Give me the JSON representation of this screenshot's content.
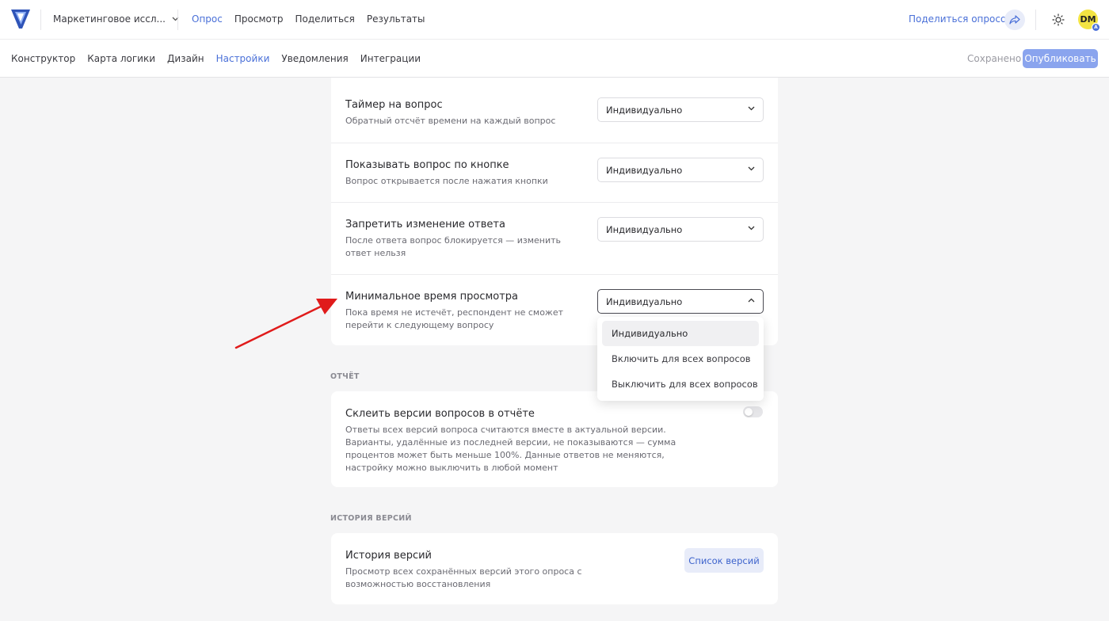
{
  "header": {
    "survey_name": "Маркетинговое иссл...",
    "nav": [
      "Опрос",
      "Просмотр",
      "Поделиться",
      "Результаты"
    ],
    "active_nav": "Опрос",
    "share_label": "Поделиться опросом",
    "avatar_initials": "DM",
    "avatar_badge": "A"
  },
  "subheader": {
    "tabs": [
      "Конструктор",
      "Карта логики",
      "Дизайн",
      "Настройки",
      "Уведомления",
      "Интеграции"
    ],
    "active_tab": "Настройки",
    "saved_label": "Сохранено",
    "publish_label": "Опубликовать"
  },
  "settings": {
    "rows": [
      {
        "title": "Таймер на вопрос",
        "desc": "Обратный отсчёт времени на каждый вопрос",
        "value": "Индивидуально"
      },
      {
        "title": "Показывать вопрос по кнопке",
        "desc": "Вопрос открывается после нажатия кнопки",
        "value": "Индивидуально"
      },
      {
        "title": "Запретить изменение ответа",
        "desc": "После ответа вопрос блокируется — изменить ответ нельзя",
        "value": "Индивидуально"
      },
      {
        "title": "Минимальное время просмотра",
        "desc": "Пока время не истечёт, респондент не сможет перейти к следующему вопросу",
        "value": "Индивидуально"
      }
    ],
    "dropdown_options": [
      "Индивидуально",
      "Включить для всех вопросов",
      "Выключить для всех вопросов"
    ],
    "dropdown_selected": "Индивидуально"
  },
  "report": {
    "section_label": "ОТЧЁТ",
    "title": "Склеить версии вопросов в отчёте",
    "desc": "Ответы всех версий вопроса считаются вместе в актуальной версии. Варианты, удалённые из последней версии, не показываются — сумма процентов может быть меньше 100%. Данные ответов не меняются, настройку можно выключить в любой момент",
    "toggle_on": false
  },
  "history": {
    "section_label": "ИСТОРИЯ ВЕРСИЙ",
    "title": "История версий",
    "desc": "Просмотр всех сохранённых версий этого опроса с возможностью восстановления",
    "button_label": "Список версий"
  },
  "colors": {
    "accent": "#4a70d8",
    "publish": "#8aa4ee",
    "arrow": "#e01b1b"
  }
}
